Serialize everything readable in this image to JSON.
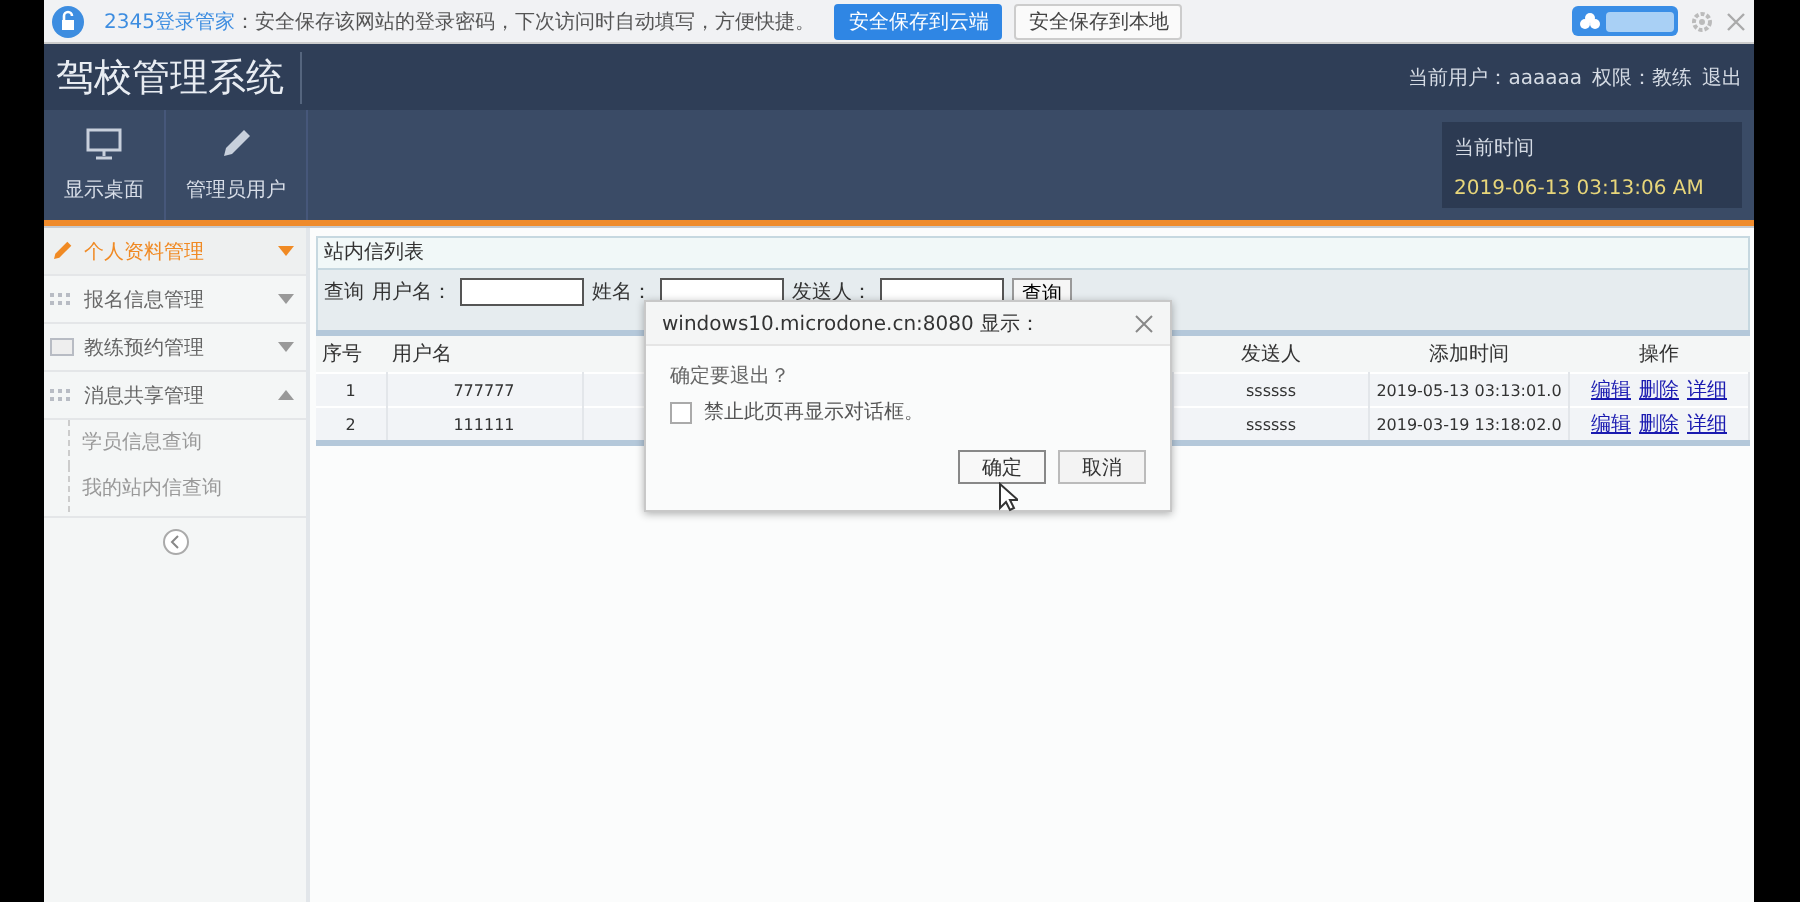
{
  "password_bar": {
    "message_brand": "2345登录管家",
    "message": "：安全保存该网站的登录密码，下次访问时自动填写，方便快捷。",
    "buttons": [
      {
        "label": "安全保存到云端",
        "kind": "primary"
      },
      {
        "label": "安全保存到本地",
        "kind": "plain"
      }
    ]
  },
  "header": {
    "title": "驾校管理系统",
    "user_label": "当前用户：",
    "user": "aaaaaa",
    "role_label": "权限：",
    "role": "教练",
    "logout": "退出"
  },
  "toolbar": {
    "items": [
      {
        "label": "显示桌面",
        "kind": "monitor"
      },
      {
        "label": "管理员用户",
        "kind": "pencil"
      }
    ],
    "clock": {
      "label": "当前时间",
      "time": "2019-06-13 03:13:06 AM"
    }
  },
  "sidebar": {
    "items": [
      {
        "label": "个人资料管理",
        "kind": "pencil",
        "selected": true,
        "expanded": false
      },
      {
        "label": "报名信息管理",
        "kind": "grid",
        "selected": false,
        "expanded": false
      },
      {
        "label": "教练预约管理",
        "kind": "card",
        "selected": false,
        "expanded": false
      },
      {
        "label": "消息共享管理",
        "kind": "grid",
        "selected": false,
        "expanded": true,
        "children": [
          {
            "label": "学员信息查询"
          },
          {
            "label": "我的站内信查询"
          }
        ]
      }
    ]
  },
  "panel": {
    "title": "站内信列表",
    "search": {
      "label": "查询",
      "fields": [
        {
          "label": "用户名："
        },
        {
          "label": "姓名："
        },
        {
          "label": "发送人："
        }
      ],
      "button": "查询"
    },
    "table": {
      "columns": [
        "序号",
        "用户名",
        "发送人",
        "添加时间",
        "操作"
      ],
      "rows": [
        {
          "cells": [
            "1",
            "777777",
            "ssssss",
            "2019-05-13 03:13:01.0"
          ],
          "actions": [
            "编辑",
            "删除",
            "详细"
          ]
        },
        {
          "cells": [
            "2",
            "111111",
            "ssssss",
            "2019-03-19 13:18:02.0"
          ],
          "actions": [
            "编辑",
            "删除",
            "详细"
          ]
        }
      ]
    }
  },
  "dialog": {
    "title": "windows10.microdone.cn:8080 显示：",
    "message": "确定要退出？",
    "checkbox": {
      "label": "禁止此页再显示对话框。",
      "checked": false
    },
    "buttons": [
      {
        "label": "确定",
        "selected": true
      },
      {
        "label": "取消",
        "selected": false
      }
    ]
  }
}
